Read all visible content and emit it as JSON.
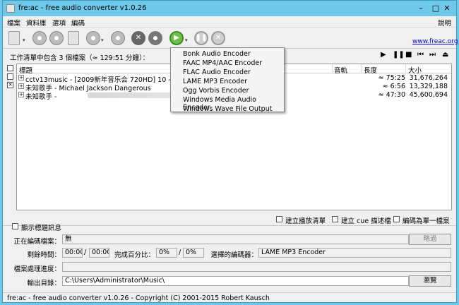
{
  "window": {
    "title": "fre:ac - free audio converter v1.0.26"
  },
  "menu": {
    "items": [
      "檔案",
      "資料庫",
      "選項",
      "編碼"
    ],
    "help": "說明"
  },
  "toolbar": {
    "website_link": "www.freac.org"
  },
  "job_list": {
    "summary": "工作清單中包含 3 個檔案（≈ 129:51 分鐘）：",
    "columns": {
      "title": "標題",
      "track": "音軌",
      "length": "長度",
      "size": "大小"
    },
    "rows": [
      {
        "title": "cctv13music - [2009新年音乐会 720HD] 10 - 乔家大",
        "length": "≈ 75:25",
        "size": "31,676,264"
      },
      {
        "title": "未知歌手 - Michael Jackson Dangerous",
        "length": "≈ 6:56",
        "size": "13,329,188"
      },
      {
        "title": "未知歌手 -",
        "length": "≈ 47:30",
        "size": "45,600,694"
      }
    ]
  },
  "encoder_menu": {
    "items": [
      "Bonk Audio Encoder",
      "FAAC MP4/AAC Encoder",
      "FLAC Audio Encoder",
      "LAME MP3 Encoder",
      "Ogg Vorbis Encoder",
      "Windows Media Audio Encoder",
      "Windows Wave File Output"
    ]
  },
  "options": {
    "create_playlist": "建立播放清單",
    "create_cue": "建立 cue 描述檔",
    "encode_single": "編碼為單一檔案",
    "show_title_info": "顯示標題訊息"
  },
  "status": {
    "encoding_file_label": "正在編碼檔案：",
    "encoding_file_value": "無",
    "skip_button": "略過",
    "remaining_label": "剩餘時間：",
    "remaining_value": "00:00",
    "remaining_total": "00:00",
    "percent_label": "完成百分比：",
    "percent_value": "0%",
    "percent_total": "0%",
    "encoder_label": "選擇的編碼器：",
    "encoder_value": "LAME MP3 Encoder",
    "progress_label": "檔案處理進度：",
    "progress": 0,
    "output_label": "輸出目錄：",
    "output_value": "C:\\Users\\Administrator\\Music\\",
    "browse_button": "瀏覽"
  },
  "statusbar": {
    "text": "fre:ac - free audio converter v1.0.26 - Copyright (C) 2001-2015 Robert Kausch"
  }
}
